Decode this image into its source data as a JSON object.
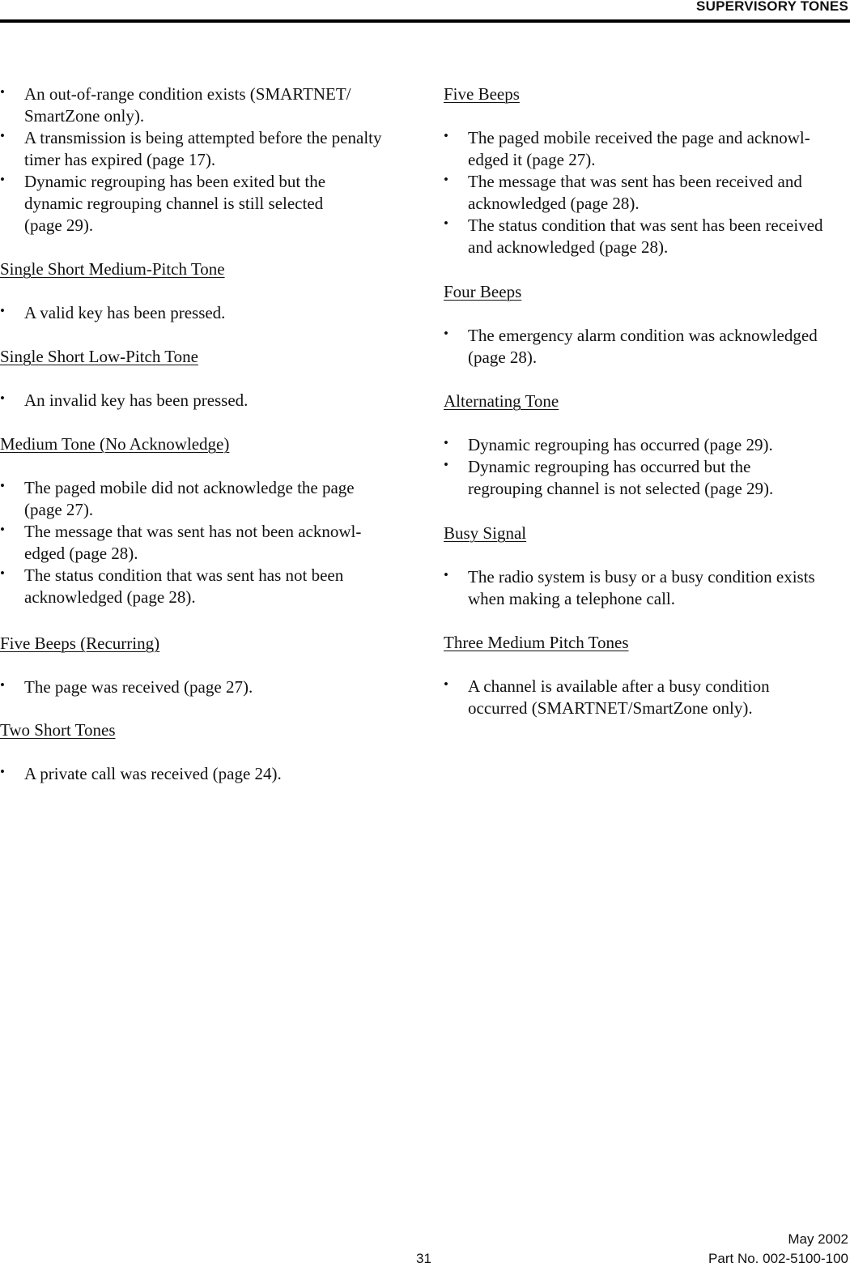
{
  "header": {
    "title": "SUPERVISORY TONES"
  },
  "left_column": {
    "intro_bullets": [
      [
        "An out-of-range condition exists (SMARTNET/",
        "SmartZone only)."
      ],
      [
        "A transmission is being attempted before the penalty",
        "timer has expired (page 17)."
      ],
      [
        "Dynamic regrouping has been exited but the",
        "dynamic regrouping channel is still selected",
        "(page 29)."
      ]
    ],
    "sections": [
      {
        "heading": "Single Short Medium-Pitch Tone",
        "bullets": [
          [
            "A valid key has been pressed."
          ]
        ]
      },
      {
        "heading": "Single Short Low-Pitch Tone",
        "bullets": [
          [
            "An invalid key has been pressed."
          ]
        ]
      },
      {
        "heading": "Medium Tone (No Acknowledge)",
        "bullets": [
          [
            "The paged mobile did not acknowledge the page",
            "(page 27)."
          ],
          [
            "The message that was sent has not been acknowl-",
            "edged (page 28)."
          ],
          [
            "The status condition that was sent has not been",
            "acknowledged (page 28)."
          ]
        ]
      },
      {
        "heading": "Five Beeps (Recurring)",
        "bullets": [
          [
            "The page was received (page 27)."
          ]
        ]
      },
      {
        "heading": "Two Short Tones ",
        "bullets": [
          [
            "A private call was received (page 24)."
          ]
        ]
      }
    ]
  },
  "right_column": {
    "sections": [
      {
        "heading": "Five Beeps",
        "bullets": [
          [
            "The paged mobile received the page and acknowl-",
            "edged it (page 27)."
          ],
          [
            "The message that was sent has been received and",
            "acknowledged (page 28)."
          ],
          [
            "The status condition that was sent has been received",
            "and acknowledged (page 28)."
          ]
        ]
      },
      {
        "heading": "Four Beeps",
        "bullets": [
          [
            "The emergency alarm condition was acknowledged",
            "(page 28)."
          ]
        ]
      },
      {
        "heading": "Alternating Tone",
        "bullets": [
          [
            "Dynamic regrouping has occurred (page 29)."
          ],
          [
            "Dynamic regrouping has occurred but the",
            "regrouping channel is not selected (page 29)."
          ]
        ]
      },
      {
        "heading": "Busy Signal",
        "bullets": [
          [
            "The radio system is busy or a busy condition exists",
            "when making a telephone call."
          ]
        ]
      },
      {
        "heading": "Three Medium Pitch Tones",
        "bullets": [
          [
            "A channel is available after a busy condition",
            "occurred (SMARTNET/SmartZone only)."
          ]
        ]
      }
    ]
  },
  "bullet_glyph": "•",
  "footer": {
    "date": "May 2002",
    "page_number": "31",
    "part_number": "Part No. 002-5100-100"
  }
}
